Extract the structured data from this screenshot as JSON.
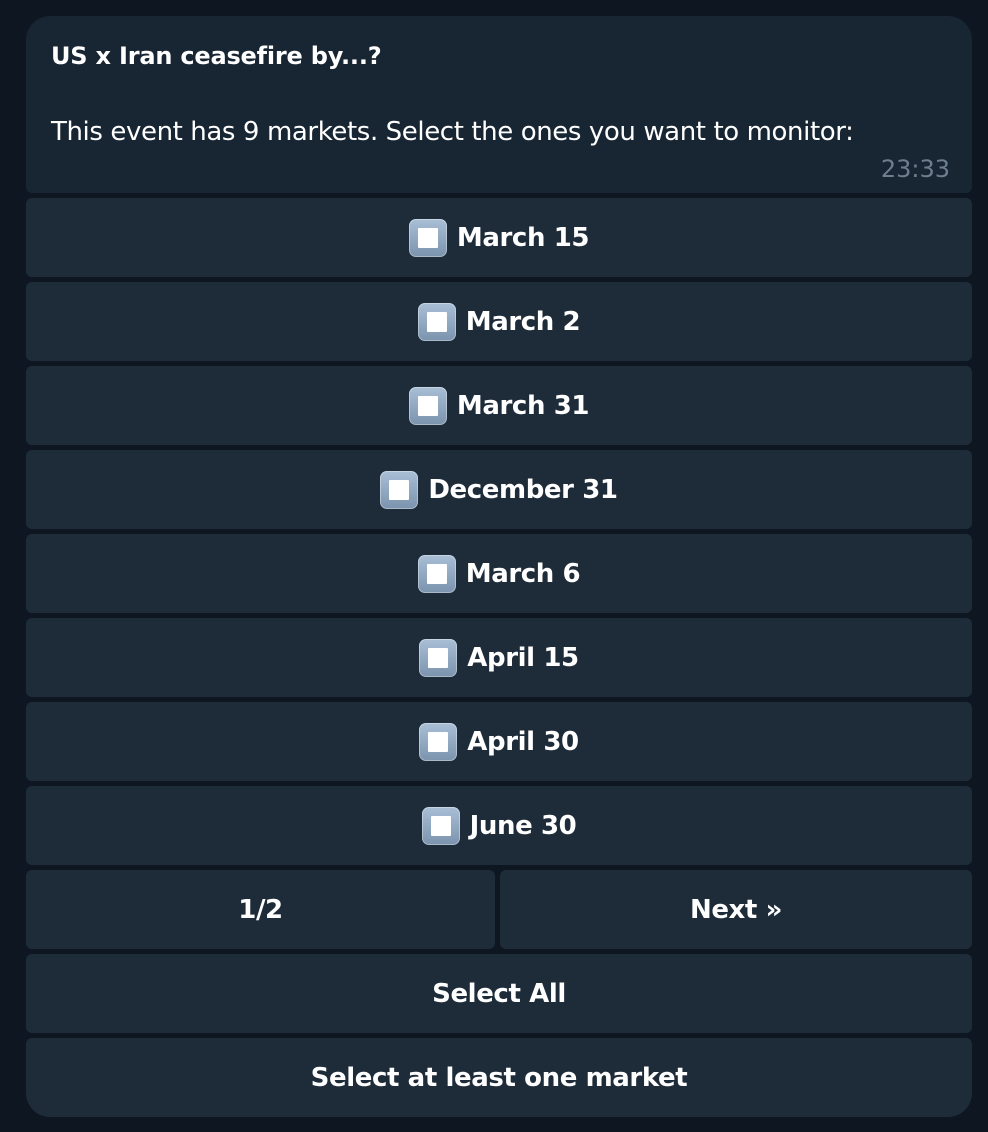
{
  "message": {
    "title": "US x Iran ceasefire by...?",
    "body": "This event has 9 markets. Select the ones you want to monitor:",
    "time": "23:33"
  },
  "markets": [
    {
      "label": "March 15",
      "checked": false
    },
    {
      "label": "March 2",
      "checked": false
    },
    {
      "label": "March 31",
      "checked": false
    },
    {
      "label": "December 31",
      "checked": false
    },
    {
      "label": "March 6",
      "checked": false
    },
    {
      "label": "April 15",
      "checked": false
    },
    {
      "label": "April 30",
      "checked": false
    },
    {
      "label": "June 30",
      "checked": false
    }
  ],
  "pagination": {
    "page_label": "1/2",
    "next_label": "Next »"
  },
  "actions": {
    "select_all_label": "Select All",
    "confirm_label": "Select at least one market"
  },
  "icons": {
    "checkbox": "white-square-button-icon"
  },
  "colors": {
    "background": "#0e1621",
    "message_bubble": "#182533",
    "button": "#1e2c3a",
    "timestamp": "#6d7f8f"
  }
}
